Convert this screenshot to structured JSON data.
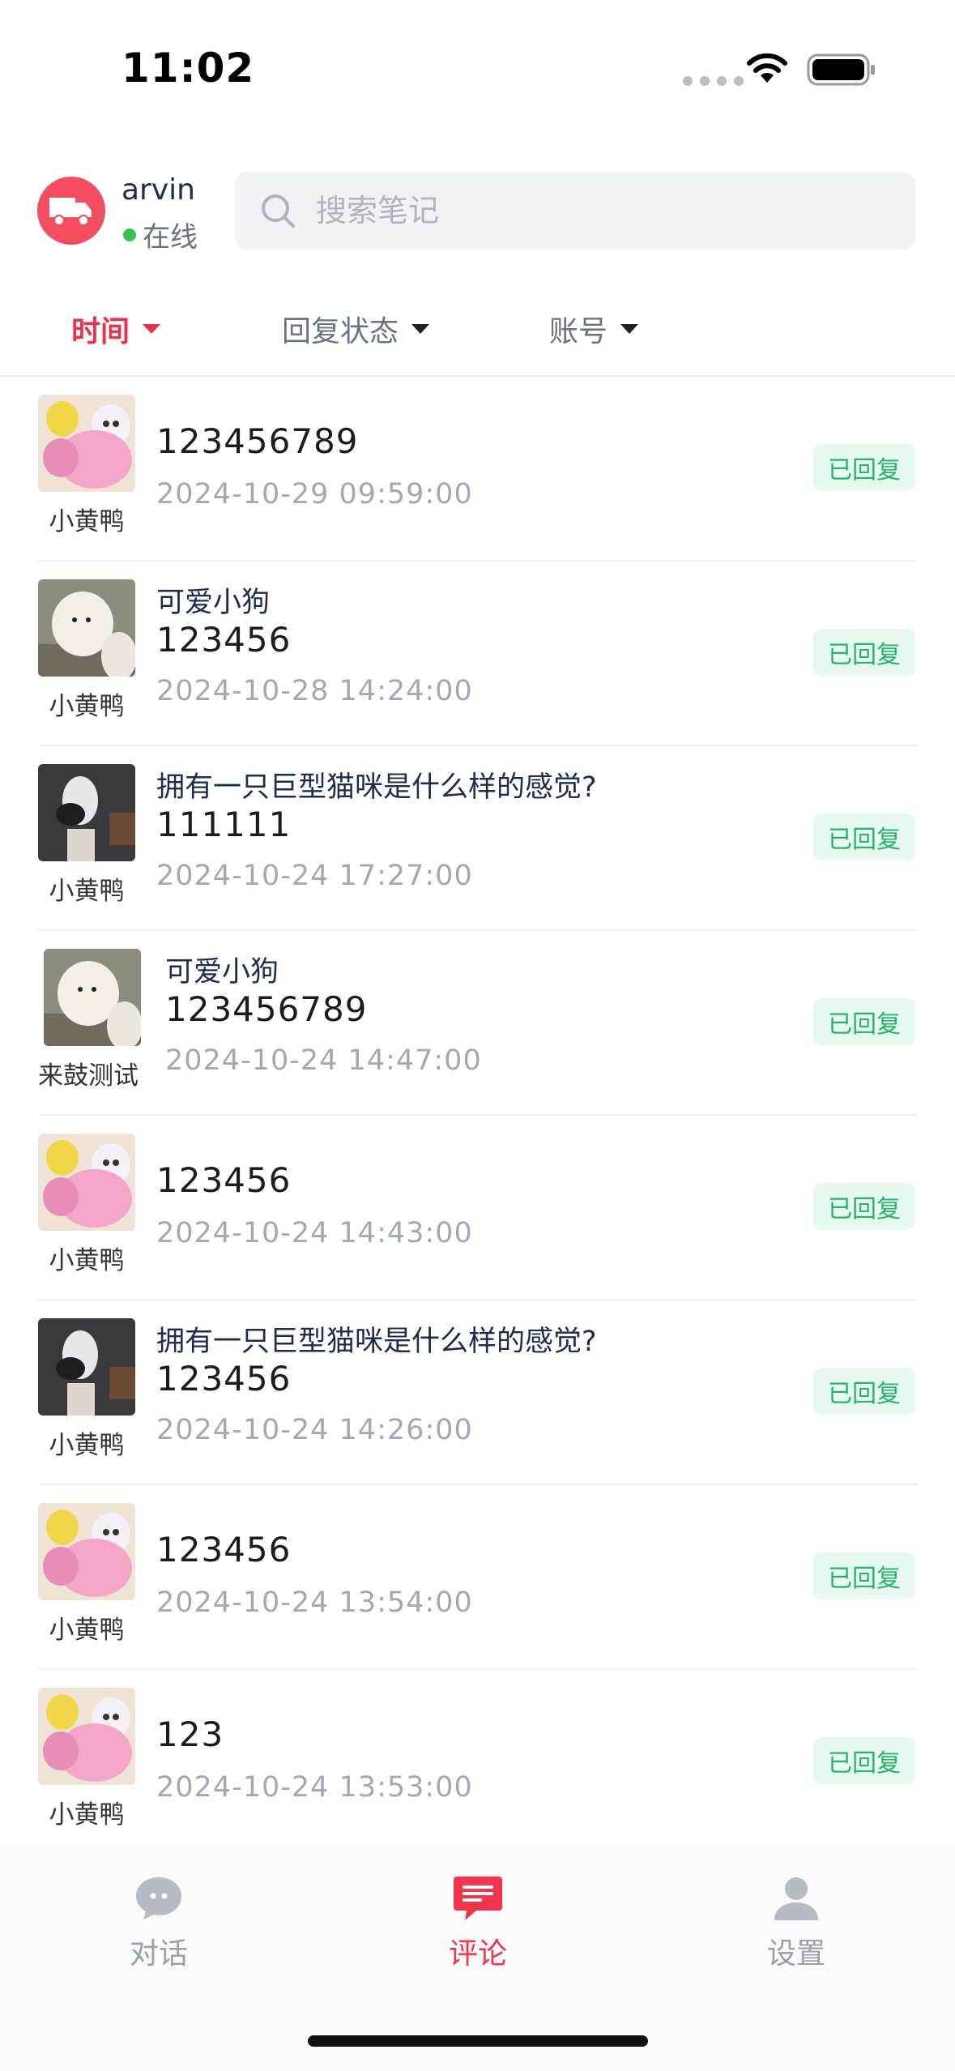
{
  "status_bar": {
    "time": "11:02"
  },
  "header": {
    "username": "arvin",
    "status": "在线",
    "search_placeholder": "搜索笔记"
  },
  "filters": [
    {
      "label": "时间",
      "active": true
    },
    {
      "label": "回复状态",
      "active": false
    },
    {
      "label": "账号",
      "active": false
    }
  ],
  "comments": [
    {
      "thumb": "plush-toys",
      "account": "小黄鸭",
      "note_title": "",
      "text": "123456789",
      "time": "2024-10-29 09:59:00",
      "status": "已回复"
    },
    {
      "thumb": "white-puppy",
      "account": "小黄鸭",
      "note_title": "可爱小狗",
      "text": "123456",
      "time": "2024-10-28 14:24:00",
      "status": "已回复"
    },
    {
      "thumb": "giant-cat",
      "account": "小黄鸭",
      "note_title": "拥有一只巨型猫咪是什么样的感觉?",
      "text": "111111",
      "time": "2024-10-24 17:27:00",
      "status": "已回复"
    },
    {
      "thumb": "white-puppy",
      "account": "来鼓测试",
      "note_title": "可爱小狗",
      "text": "123456789",
      "time": "2024-10-24 14:47:00",
      "status": "已回复"
    },
    {
      "thumb": "plush-toys",
      "account": "小黄鸭",
      "note_title": "",
      "text": "123456",
      "time": "2024-10-24 14:43:00",
      "status": "已回复"
    },
    {
      "thumb": "giant-cat",
      "account": "小黄鸭",
      "note_title": "拥有一只巨型猫咪是什么样的感觉?",
      "text": "123456",
      "time": "2024-10-24 14:26:00",
      "status": "已回复"
    },
    {
      "thumb": "plush-toys",
      "account": "小黄鸭",
      "note_title": "",
      "text": "123456",
      "time": "2024-10-24 13:54:00",
      "status": "已回复"
    },
    {
      "thumb": "plush-toys",
      "account": "小黄鸭",
      "note_title": "",
      "text": "123",
      "time": "2024-10-24 13:53:00",
      "status": "已回复"
    }
  ],
  "tabbar": [
    {
      "label": "对话",
      "icon": "chat-bubble-icon",
      "active": false
    },
    {
      "label": "评论",
      "icon": "comment-icon",
      "active": true
    },
    {
      "label": "设置",
      "icon": "person-icon",
      "active": false
    }
  ],
  "colors": {
    "accent": "#f0364f",
    "replied_text": "#27b36a",
    "replied_bg": "#e6f8ef"
  }
}
